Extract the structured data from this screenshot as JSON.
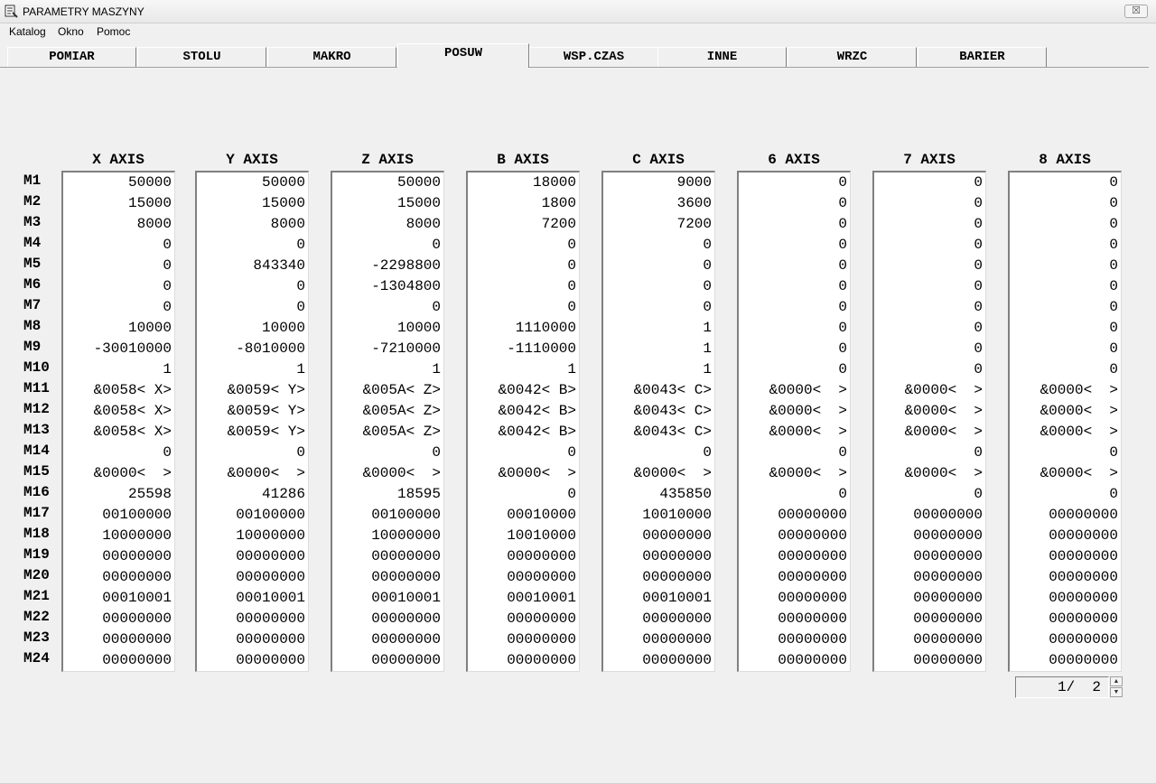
{
  "window": {
    "title": "PARAMETRY MASZYNY",
    "close_label": "☒"
  },
  "menu": [
    "Katalog",
    "Okno",
    "Pomoc"
  ],
  "tabs": [
    "POMIAR",
    "STOLU",
    "MAKRO",
    "POSUW",
    "WSP.CZAS",
    "INNE",
    "WRZC",
    "BARIER"
  ],
  "active_tab": "POSUW",
  "columns": [
    "X AXIS",
    "Y AXIS",
    "Z AXIS",
    "B AXIS",
    "C AXIS",
    "6 AXIS",
    "7 AXIS",
    "8 AXIS"
  ],
  "rows": [
    {
      "label": "M1",
      "values": [
        "50000",
        "50000",
        "50000",
        "18000",
        "9000",
        "0",
        "0",
        "0"
      ]
    },
    {
      "label": "M2",
      "values": [
        "15000",
        "15000",
        "15000",
        "1800",
        "3600",
        "0",
        "0",
        "0"
      ]
    },
    {
      "label": "M3",
      "values": [
        "8000",
        "8000",
        "8000",
        "7200",
        "7200",
        "0",
        "0",
        "0"
      ]
    },
    {
      "label": "M4",
      "values": [
        "0",
        "0",
        "0",
        "0",
        "0",
        "0",
        "0",
        "0"
      ]
    },
    {
      "label": "M5",
      "values": [
        "0",
        "843340",
        "-2298800",
        "0",
        "0",
        "0",
        "0",
        "0"
      ]
    },
    {
      "label": "M6",
      "values": [
        "0",
        "0",
        "-1304800",
        "0",
        "0",
        "0",
        "0",
        "0"
      ]
    },
    {
      "label": "M7",
      "values": [
        "0",
        "0",
        "0",
        "0",
        "0",
        "0",
        "0",
        "0"
      ]
    },
    {
      "label": "M8",
      "values": [
        "10000",
        "10000",
        "10000",
        "1110000",
        "1",
        "0",
        "0",
        "0"
      ]
    },
    {
      "label": "M9",
      "values": [
        "-30010000",
        "-8010000",
        "-7210000",
        "-1110000",
        "1",
        "0",
        "0",
        "0"
      ]
    },
    {
      "label": "M10",
      "values": [
        "1",
        "1",
        "1",
        "1",
        "1",
        "0",
        "0",
        "0"
      ]
    },
    {
      "label": "M11",
      "values": [
        "&0058< X>",
        "&0059< Y>",
        "&005A< Z>",
        "&0042< B>",
        "&0043< C>",
        "&0000<  >",
        "&0000<  >",
        "&0000<  >"
      ]
    },
    {
      "label": "M12",
      "values": [
        "&0058< X>",
        "&0059< Y>",
        "&005A< Z>",
        "&0042< B>",
        "&0043< C>",
        "&0000<  >",
        "&0000<  >",
        "&0000<  >"
      ]
    },
    {
      "label": "M13",
      "values": [
        "&0058< X>",
        "&0059< Y>",
        "&005A< Z>",
        "&0042< B>",
        "&0043< C>",
        "&0000<  >",
        "&0000<  >",
        "&0000<  >"
      ]
    },
    {
      "label": "M14",
      "values": [
        "0",
        "0",
        "0",
        "0",
        "0",
        "0",
        "0",
        "0"
      ]
    },
    {
      "label": "M15",
      "values": [
        "&0000<  >",
        "&0000<  >",
        "&0000<  >",
        "&0000<  >",
        "&0000<  >",
        "&0000<  >",
        "&0000<  >",
        "&0000<  >"
      ]
    },
    {
      "label": "M16",
      "values": [
        "25598",
        "41286",
        "18595",
        "0",
        "435850",
        "0",
        "0",
        "0"
      ]
    },
    {
      "label": "M17",
      "values": [
        "00100000",
        "00100000",
        "00100000",
        "00010000",
        "10010000",
        "00000000",
        "00000000",
        "00000000"
      ]
    },
    {
      "label": "M18",
      "values": [
        "10000000",
        "10000000",
        "10000000",
        "10010000",
        "00000000",
        "00000000",
        "00000000",
        "00000000"
      ]
    },
    {
      "label": "M19",
      "values": [
        "00000000",
        "00000000",
        "00000000",
        "00000000",
        "00000000",
        "00000000",
        "00000000",
        "00000000"
      ]
    },
    {
      "label": "M20",
      "values": [
        "00000000",
        "00000000",
        "00000000",
        "00000000",
        "00000000",
        "00000000",
        "00000000",
        "00000000"
      ]
    },
    {
      "label": "M21",
      "values": [
        "00010001",
        "00010001",
        "00010001",
        "00010001",
        "00010001",
        "00000000",
        "00000000",
        "00000000"
      ]
    },
    {
      "label": "M22",
      "values": [
        "00000000",
        "00000000",
        "00000000",
        "00000000",
        "00000000",
        "00000000",
        "00000000",
        "00000000"
      ]
    },
    {
      "label": "M23",
      "values": [
        "00000000",
        "00000000",
        "00000000",
        "00000000",
        "00000000",
        "00000000",
        "00000000",
        "00000000"
      ]
    },
    {
      "label": "M24",
      "values": [
        "00000000",
        "00000000",
        "00000000",
        "00000000",
        "00000000",
        "00000000",
        "00000000",
        "00000000"
      ]
    }
  ],
  "pager": {
    "text": "1/  2"
  }
}
